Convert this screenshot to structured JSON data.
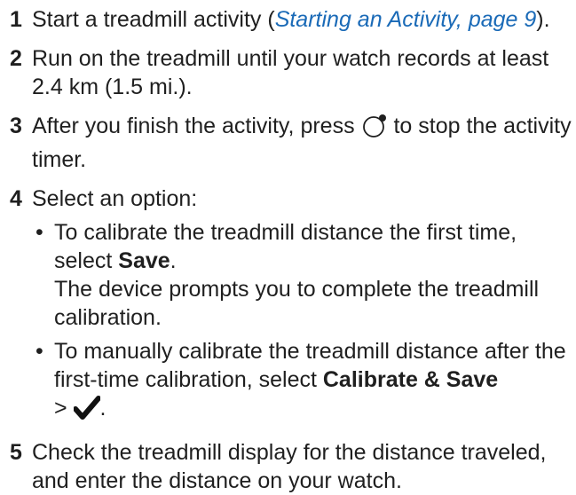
{
  "steps": [
    {
      "num": "1",
      "pre": "Start a treadmill activity (",
      "link": "Starting an Activity, page 9",
      "post": ")."
    },
    {
      "num": "2",
      "text": "Run on the treadmill until your watch records at least 2.4 km (1.5 mi.)."
    },
    {
      "num": "3",
      "pre": "After you finish the activity, press ",
      "post": " to stop the activity timer."
    },
    {
      "num": "4",
      "text": "Select an option:",
      "options": [
        {
          "bullet": "•",
          "pre": "To calibrate the treadmill distance the first time, select ",
          "bold": "Save",
          "post": ".",
          "note": "The device prompts you to complete the treadmill calibration."
        },
        {
          "bullet": "•",
          "pre": "To manually calibrate the treadmill distance after the first-time calibration, select ",
          "bold": "Calibrate & Save",
          "sep": " > ",
          "post": "."
        }
      ]
    },
    {
      "num": "5",
      "text": "Check the treadmill display for the distance traveled, and enter the distance on your watch."
    }
  ],
  "icons": {
    "watch_button": "watch-button-icon",
    "checkmark": "checkmark-icon"
  }
}
